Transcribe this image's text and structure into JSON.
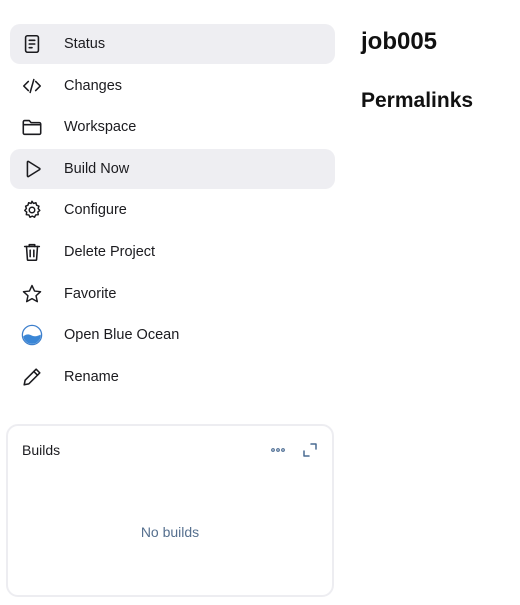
{
  "job": {
    "title": "job005"
  },
  "sections": {
    "permalinks": "Permalinks"
  },
  "sidebar": {
    "items": [
      {
        "label": "Status",
        "icon": "document-icon"
      },
      {
        "label": "Changes",
        "icon": "code-icon"
      },
      {
        "label": "Workspace",
        "icon": "folder-icon"
      },
      {
        "label": "Build Now",
        "icon": "play-icon"
      },
      {
        "label": "Configure",
        "icon": "gear-icon"
      },
      {
        "label": "Delete Project",
        "icon": "trash-icon"
      },
      {
        "label": "Favorite",
        "icon": "star-icon"
      },
      {
        "label": "Open Blue Ocean",
        "icon": "blue-ocean-icon"
      },
      {
        "label": "Rename",
        "icon": "pencil-icon"
      }
    ]
  },
  "builds": {
    "title": "Builds",
    "empty_text": "No builds"
  },
  "colors": {
    "active_bg": "#eeeef2",
    "card_border": "#ededf1",
    "muted_text": "#56708f",
    "accent_blue": "#4a90d9"
  }
}
